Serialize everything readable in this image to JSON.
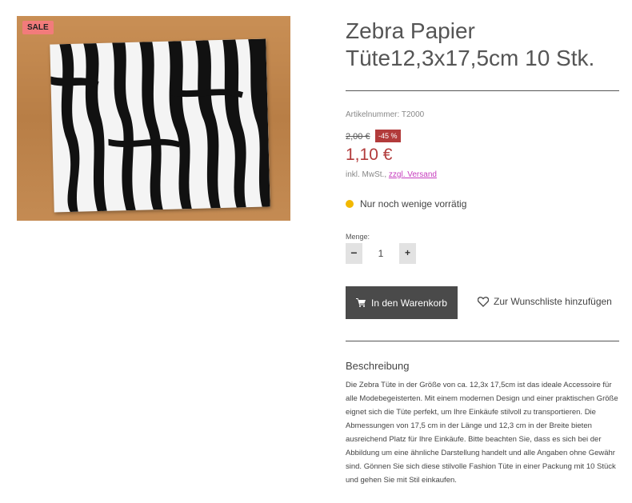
{
  "product": {
    "image_alt": "Zebra Papier Tüte",
    "sale_badge": "SALE",
    "title_line1": "Zebra Papier",
    "title_line2": "Tüte12,3x17,5cm 10 Stk.",
    "sku": "Artikelnummer: T2000",
    "old_price": "2,00 €",
    "discount": "-45 %",
    "price": "1,10 €",
    "tax_text": "inkl. MwSt.,",
    "shipping_link": "zzgl. Versand",
    "stock_status": "Nur noch wenige vorrätig",
    "stock_color": "#f2b800",
    "sale_color": "#b23b3b"
  },
  "quantity": {
    "label": "Menge:",
    "value": "1",
    "minus": "−",
    "plus": "+"
  },
  "actions": {
    "cart_label": "In den Warenkorb",
    "cart_icon": "shopping-cart-icon",
    "wishlist_label": "Zur Wunschliste hinzufügen",
    "wishlist_icon": "heart-icon"
  },
  "description": {
    "heading": "Beschreibung",
    "text": "Die Zebra Tüte in der Größe von ca. 12,3x 17,5cm ist das ideale Accessoire für alle Modebegeisterten. Mit einem modernen Design und einer praktischen Größe eignet sich die Tüte perfekt, um Ihre Einkäufe stilvoll zu transportieren. Die Abmessungen von 17,5 cm in der Länge und 12,3 cm in der Breite bieten ausreichend Platz für Ihre Einkäufe. Bitte beachten Sie, dass es sich bei der Abbildung um eine ähnliche Darstellung handelt und alle Angaben ohne Gewähr sind. Gönnen Sie sich diese stilvolle Fashion Tüte in einer Packung mit 10 Stück und gehen Sie mit Stil einkaufen."
  }
}
